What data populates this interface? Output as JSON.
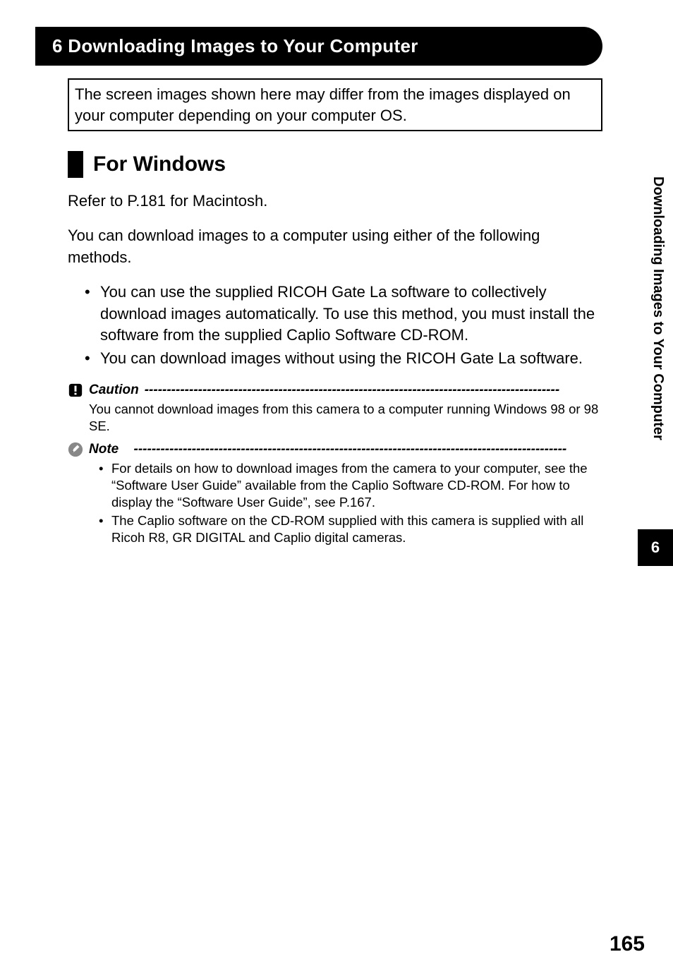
{
  "chapterHeader": "6   Downloading Images to Your Computer",
  "infoBox": "The screen images shown here may differ from the images displayed on your computer depending on your computer OS.",
  "sectionTitle": "For Windows",
  "para1": "Refer to P.181 for Macintosh.",
  "para2": "You can download images to a computer using either of the following methods.",
  "bullets": {
    "b1": "You can use the supplied RICOH Gate La software to collectively download images automatically. To use this method, you must install the software from the supplied Caplio Software CD-ROM.",
    "b2": "You can download images without using the RICOH Gate La software."
  },
  "caution": {
    "label": "Caution",
    "dashes": "---------------------------------------------------------------------------------------------",
    "body": "You cannot download images from this camera to a computer running Windows 98 or 98 SE."
  },
  "note": {
    "label": "Note",
    "dashes": "-------------------------------------------------------------------------------------------------",
    "items": {
      "n1": "For details on how to download images from the camera to your computer, see the “Software User Guide” available from the Caplio Software CD-ROM. For how to display the “Software User Guide”, see P.167.",
      "n2": "The Caplio software on the CD-ROM supplied with this camera is supplied with all Ricoh R8, GR DIGITAL and Caplio digital cameras."
    }
  },
  "sideText": "Downloading Images to Your Computer",
  "sideNumber": "6",
  "pageNumber": "165"
}
